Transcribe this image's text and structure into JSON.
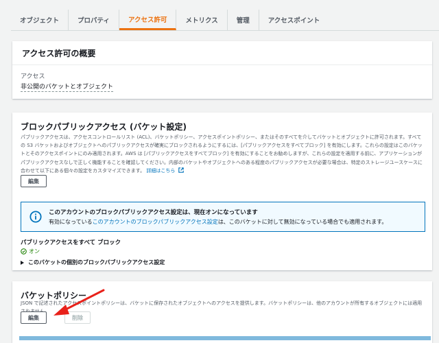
{
  "tabs": [
    {
      "label": "オブジェクト",
      "active": false
    },
    {
      "label": "プロパティ",
      "active": false
    },
    {
      "label": "アクセス許可",
      "active": true
    },
    {
      "label": "メトリクス",
      "active": false
    },
    {
      "label": "管理",
      "active": false
    },
    {
      "label": "アクセスポイント",
      "active": false
    }
  ],
  "overview": {
    "title": "アクセス許可の概要",
    "access_label": "アクセス",
    "access_value": "非公開のバケットとオブジェクト"
  },
  "block_public": {
    "title": "ブロックパブリックアクセス (バケット設定)",
    "description": "パブリックアクセスは、アクセスコントロールリスト (ACL)、バケットポリシー、アクセスポイントポリシー、またはそのすべてを介してバケットとオブジェクトに許可されます。すべての S3 バケットおよびオブジェクトへのパブリックアクセスが確実にブロックされるようにするには、[パブリックアクセスをすべてブロック] を有効にします。これらの設定はこのバケットとそのアクセスポイントにのみ適用されます。AWS は [パブリックアクセスをすべてブロック] を有効にすることをお勧めしますが、これらの設定を適用する前に、アプリケーションがパブリックアクセスなしで正しく機能することを確認してください。内部のバケットやオブジェクトへのある程度のパブリックアクセスが必要な場合は、特定のストレージユースケースに合わせて以下にある個々の設定をカスタマイズできます。",
    "learn_more": "詳細はこちら",
    "edit_label": "編集",
    "info_title": "このアカウントのブロックパブリックアクセス設定は、現在オンになっています",
    "info_prefix": "有効になっている",
    "info_link": "このアカウントのブロックパブリックアクセス設定",
    "info_suffix": "は、このバケットに対して無効になっている場合でも適用されます。",
    "block_all_label": "パブリックアクセスをすべて ブロック",
    "status_text": "オン",
    "expander_label": "このバケットの個別のブロックパブリックアクセス設定"
  },
  "bucket_policy": {
    "title": "バケットポリシー",
    "description": "JSON で記述されたアクセスポイントポリシーは、バケットに保存されたオブジェクトへのアクセスを提供します。バケットポリシーは、他のアカウントが所有するオブジェクトには適用されません。",
    "edit_label": "編集",
    "delete_label": "削除"
  },
  "colors": {
    "accent": "#ec7211",
    "link": "#0073bb",
    "success": "#1d8102"
  }
}
